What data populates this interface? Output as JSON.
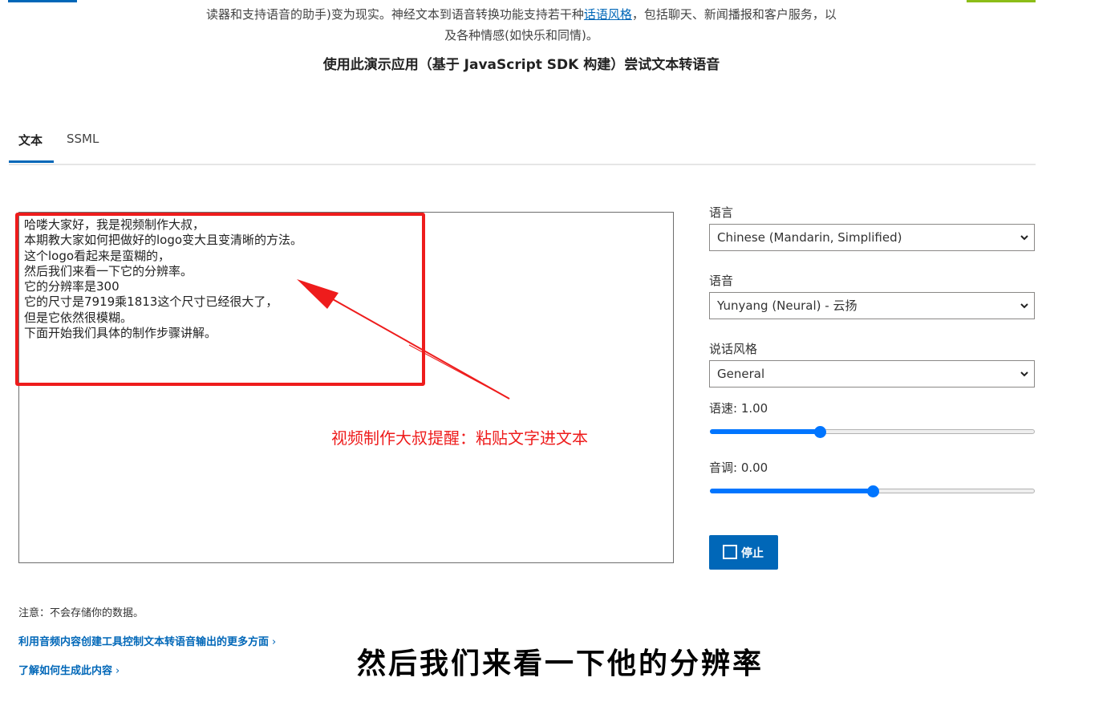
{
  "intro": {
    "line1_before": "读器和支持语音的助手)变为现实。神经文本到语音转换功能支持若干种",
    "line1_link": "话语风格",
    "line1_after": "，包括聊天、新闻播报和客户服务，以",
    "line2": "及各种情感(如快乐和同情)。",
    "subhead": "使用此演示应用（基于 JavaScript SDK 构建）尝试文本转语音"
  },
  "tabs": [
    {
      "label": "文本",
      "selected": true
    },
    {
      "label": "SSML",
      "selected": false
    }
  ],
  "editor": {
    "text": "哈喽大家好，我是视频制作大叔，\n本期教大家如何把做好的logo变大且变清晰的方法。\n这个logo看起来是蛮糊的，\n然后我们来看一下它的分辨率。\n它的分辨率是300\n它的尺寸是7919乘1813这个尺寸已经很大了，\n但是它依然很模糊。\n下面开始我们具体的制作步骤讲解。"
  },
  "annotation": {
    "note": "视频制作大叔提醒：粘贴文字进文本",
    "color": "#ee1c1c"
  },
  "settings": {
    "language_label": "语言",
    "language_value": "Chinese (Mandarin, Simplified)",
    "voice_label": "语音",
    "voice_value": "Yunyang (Neural) - 云扬",
    "style_label": "说话风格",
    "style_value": "General",
    "rate_label": "语速: 1.00",
    "rate_fraction": 0.338,
    "pitch_label": "音调: 0.00",
    "pitch_fraction": 0.5,
    "stop_label": "停止",
    "accent_color": "#0067b8"
  },
  "footer": {
    "note": "注意：不会存储你的数据。",
    "link1": "利用音频内容创建工具控制文本转语音输出的更多方面",
    "link2": "了解如何生成此内容"
  },
  "video_subtitle": "然后我们来看一下他的分辨率"
}
